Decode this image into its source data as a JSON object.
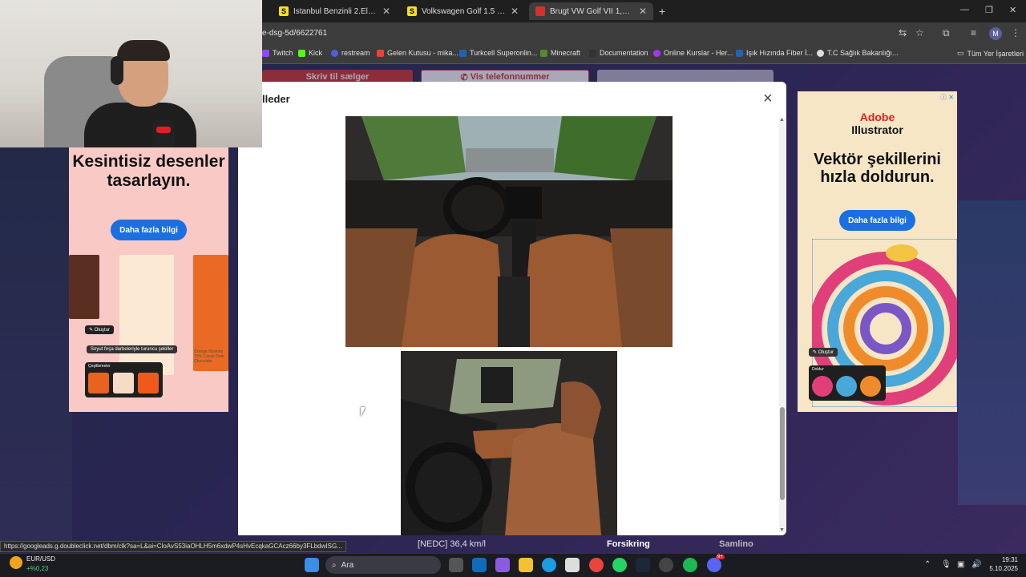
{
  "browser": {
    "tabs": [
      {
        "title": "İstanbul Benzinli 2.El Arabalar v",
        "favicon": "S",
        "color": "#f5e01c"
      },
      {
        "title": "Volkswagen Golf 1.5 eTSI Fiyatl",
        "favicon": "S",
        "color": "#f5e01c"
      },
      {
        "title": "Brugt VW Golf VII 1,4 GTE High",
        "favicon": "",
        "color": "#d2322d"
      }
    ],
    "new_tab": "+",
    "url": "e-dsg-5d/6622761",
    "profile_initial": "M",
    "bookmarks": [
      {
        "label": "Twitch",
        "color": "#9146ff"
      },
      {
        "label": "Kick",
        "color": "#53fc18"
      },
      {
        "label": "restream",
        "color": "#4b5ee8"
      },
      {
        "label": "Gelen Kutusu - mika...",
        "color": "#ea4335"
      },
      {
        "label": "Turkcell Superonlin...",
        "color": "#1e63b5"
      },
      {
        "label": "Minecraft",
        "color": "#4f8c2b"
      },
      {
        "label": "Documentation",
        "color": "#333333"
      },
      {
        "label": "Online Kurslar - Her...",
        "color": "#a435f0"
      },
      {
        "label": "Işık Hızında Fiber İ...",
        "color": "#1e63b5"
      },
      {
        "label": "T.C Sağlık Bakanlığı...",
        "color": "#dddddd"
      }
    ],
    "all_bookmarks": "Tüm Yer İşaretleri"
  },
  "page": {
    "behind_buttons": {
      "write": "Skriv til sælger",
      "phone": "Vis telefonnummer"
    },
    "modal": {
      "title": "lleder",
      "close": "×"
    },
    "below_modal": {
      "nedc": "[NEDC] 36,4 km/l",
      "insurance": "Forsikring",
      "brand": "Samlino"
    }
  },
  "ad_left": {
    "headline": "Kesintisiz desenler tasarlayın.",
    "cta": "Daha fazla bilgi",
    "tag_create": "Oluştur",
    "prompt": "Soyut fırça darbeleriyle turuncu şekiller",
    "variations": "Çeşitlemeler",
    "package_text": "Orange Illusions 70% Cacao Dark Chocolate"
  },
  "ad_right": {
    "brand_line1": "Adobe",
    "brand_line2": "Illustrator",
    "headline": "Vektör şekillerini hızla doldurun.",
    "cta": "Daha fazla bilgi",
    "tag_create": "Oluştur",
    "fill": "Doldur",
    "info": "ⓘ ✕"
  },
  "status_url": "https://googleads.g.doubleclick.net/dbm/clk?sa=L&ai=CloAvS53iaOHLH5m6xdwP4sHvEcqkaGCAcz66by3FLbdwISG...",
  "taskbar": {
    "ticker_name": "EUR/USD",
    "ticker_change": "+%0,23",
    "search_placeholder": "Ara",
    "time": "19:31",
    "date": "5.10.2025",
    "badge": "9+"
  }
}
